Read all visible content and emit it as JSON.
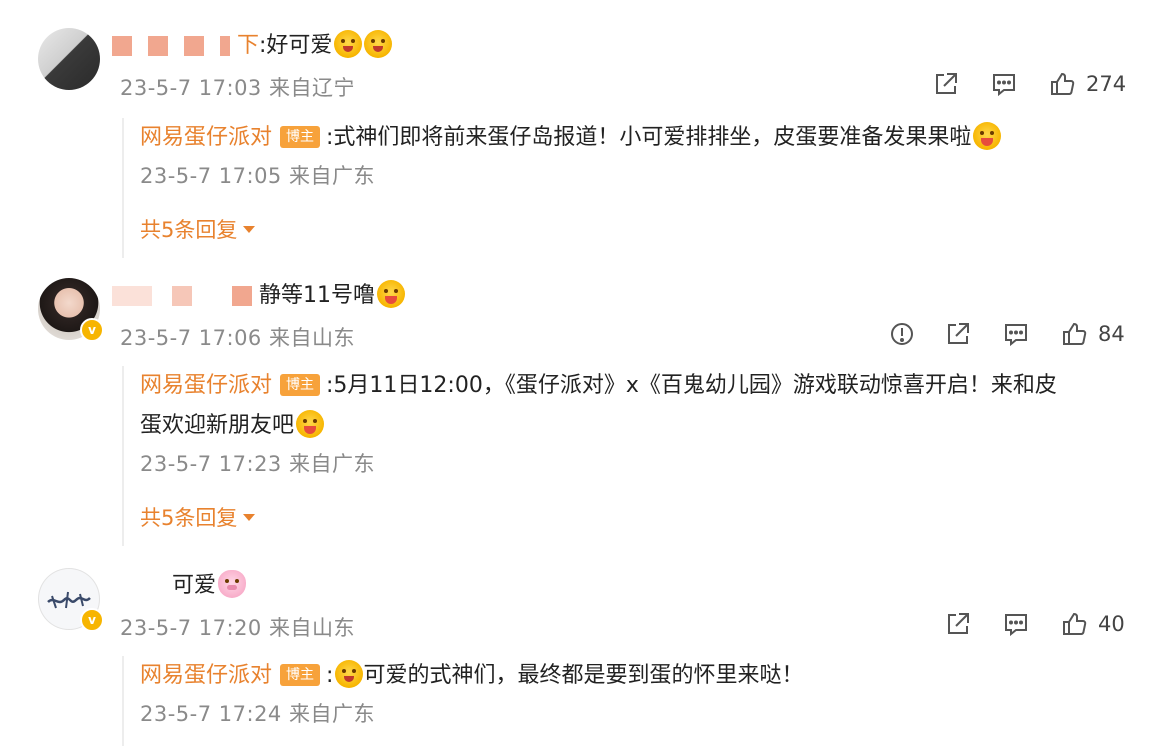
{
  "comments": [
    {
      "name_suffix": "下",
      "text": ":好可爱",
      "emojis": [
        "cry-laugh-emoji",
        "cry-laugh-emoji"
      ],
      "meta": "23-5-7 17:03 来自辽宁",
      "likes": "274",
      "reply": {
        "author": "网易蛋仔派对",
        "tag": "博主",
        "text": ":式神们即将前来蛋仔岛报道！小可爱排排坐，皮蛋要准备发果果啦",
        "meta": "23-5-7 17:05 来自广东"
      },
      "more": "共5条回复"
    },
    {
      "name_suffix": "静等11号噜",
      "text": "",
      "meta": "23-5-7 17:06 来自山东",
      "likes": "84",
      "reply": {
        "author": "网易蛋仔派对",
        "tag": "博主",
        "text_line1": ":5月11日12:00，《蛋仔派对》x《百鬼幼儿园》游戏联动惊喜开启！来和皮",
        "text_line2": "蛋欢迎新朋友吧",
        "meta": "23-5-7 17:23 来自广东"
      },
      "more": "共5条回复"
    },
    {
      "text": "可爱",
      "meta": "23-5-7 17:20 来自山东",
      "likes": "40",
      "reply": {
        "author": "网易蛋仔派对",
        "tag": "博主",
        "text": "可爱的式神们，最终都是要到蛋的怀里来哒！",
        "meta": "23-5-7 17:24 来自广东"
      }
    }
  ],
  "colors": {
    "author": "#e8822e",
    "meta": "#8a8a8a",
    "blogger_tag": "#f7a23b",
    "verified_badge": "#f7b500"
  },
  "icons": [
    "share-icon",
    "comment-icon",
    "like-icon",
    "report-icon"
  ]
}
